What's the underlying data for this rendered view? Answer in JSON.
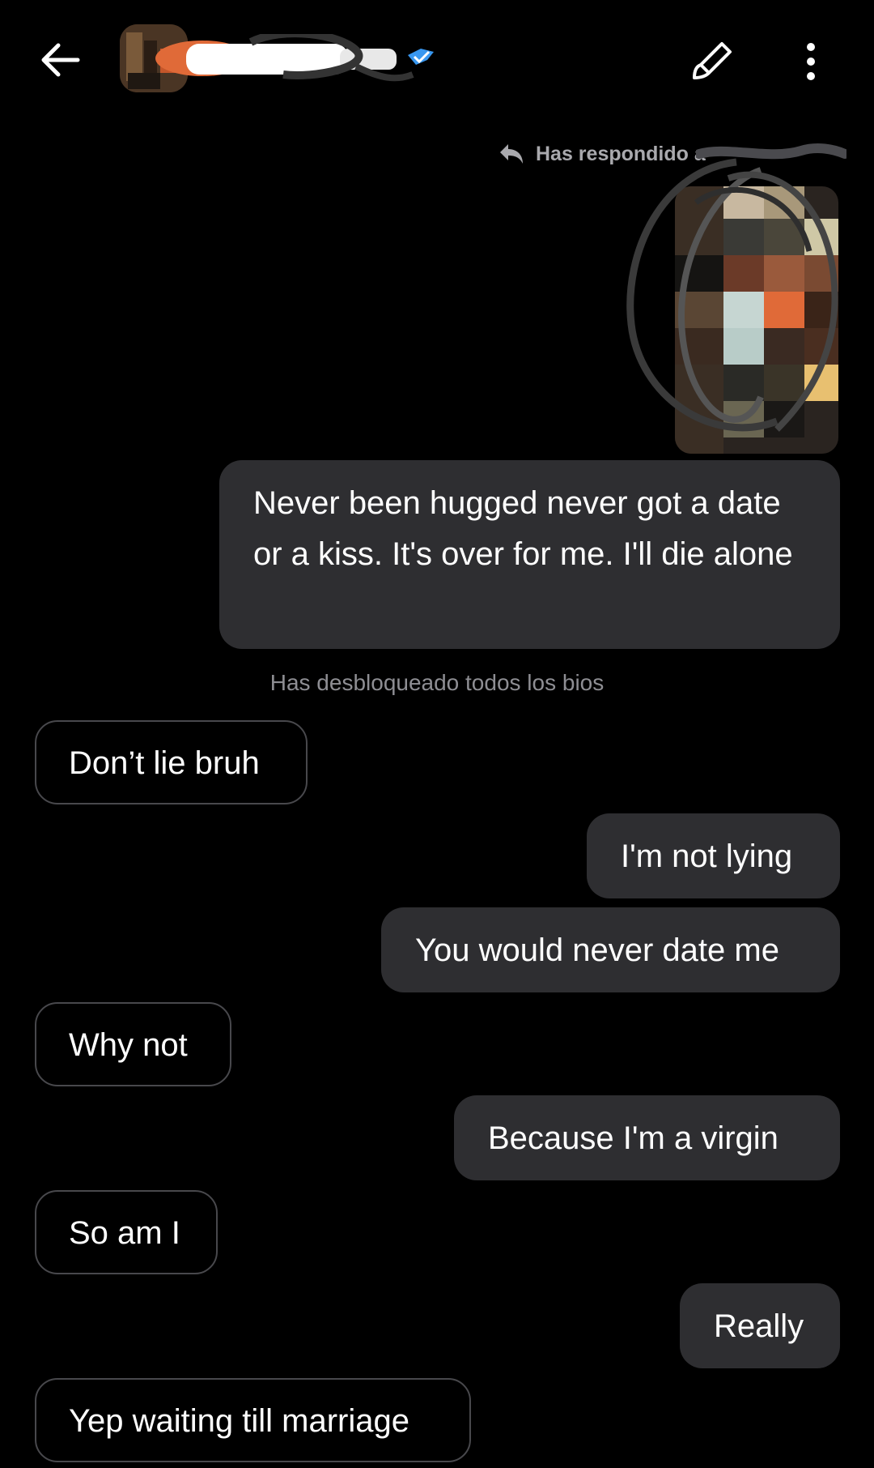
{
  "header": {
    "back_icon": "arrow-left-icon",
    "verified_icon": "verified-badge-icon",
    "edit_icon": "brush-icon",
    "more_icon": "more-vertical-icon",
    "verified_color": "#3897f0"
  },
  "reply_context": {
    "icon": "reply-arrow-icon",
    "text": "Has respondido a"
  },
  "messages": [
    {
      "side": "out",
      "text": "Never been hugged never got a date or a kiss. It's over for me. I'll die alone"
    },
    {
      "side": "system",
      "text": "Has desbloqueado todos los bios"
    },
    {
      "side": "in",
      "text": "Don’t lie bruh"
    },
    {
      "side": "out",
      "text": "I'm not lying"
    },
    {
      "side": "out",
      "text": "You would never date me"
    },
    {
      "side": "in",
      "text": "Why not"
    },
    {
      "side": "out",
      "text": "Because I'm a virgin"
    },
    {
      "side": "in",
      "text": "So am I"
    },
    {
      "side": "out",
      "text": "Really"
    },
    {
      "side": "in",
      "text": "Yep waiting till marriage"
    }
  ],
  "colors": {
    "background": "#000000",
    "outgoing_bubble": "#2e2e31",
    "incoming_border": "#48484c",
    "system_text": "#8e8e93",
    "reply_text": "#a9a9ad"
  }
}
